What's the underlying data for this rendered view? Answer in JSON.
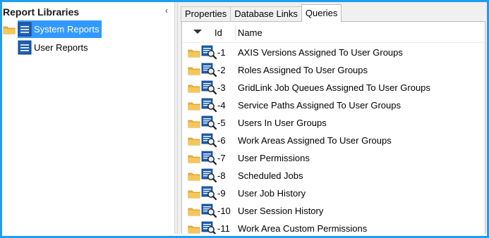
{
  "left_panel": {
    "title": "Report Libraries",
    "collapse_glyph": "‹",
    "items": [
      {
        "label": "System Reports",
        "selected": true,
        "icon": "report-library-icon"
      },
      {
        "label": "User Reports",
        "selected": false,
        "icon": "report-library-icon"
      }
    ]
  },
  "tabs": [
    {
      "label": "Properties",
      "active": false
    },
    {
      "label": "Database Links",
      "active": false
    },
    {
      "label": "Queries",
      "active": true
    }
  ],
  "grid": {
    "columns": {
      "id": "Id",
      "name": "Name"
    },
    "rows": [
      {
        "id": "-1",
        "name": "AXIS Versions Assigned To User Groups"
      },
      {
        "id": "-2",
        "name": "Roles Assigned To User Groups"
      },
      {
        "id": "-3",
        "name": "GridLink Job Queues Assigned To User Groups"
      },
      {
        "id": "-4",
        "name": "Service Paths Assigned To User Groups"
      },
      {
        "id": "-5",
        "name": "Users In User Groups"
      },
      {
        "id": "-6",
        "name": "Work Areas Assigned To User Groups"
      },
      {
        "id": "-7",
        "name": "User Permissions"
      },
      {
        "id": "-8",
        "name": "Scheduled Jobs"
      },
      {
        "id": "-9",
        "name": "User Job History"
      },
      {
        "id": "-10",
        "name": "User Session History"
      },
      {
        "id": "-11",
        "name": "Work Area Custom Permissions"
      }
    ]
  },
  "colors": {
    "frame": "#1e9ef0",
    "selection": "#3399ff",
    "library_icon": "#1f5fb0",
    "folder": "#f0b43c"
  }
}
